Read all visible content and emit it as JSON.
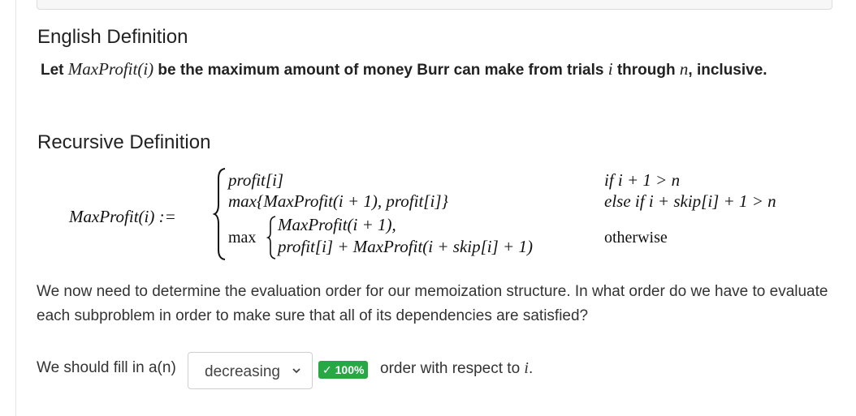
{
  "headings": {
    "english": "English Definition",
    "recursive": "Recursive Definition"
  },
  "definition": {
    "let": "Let",
    "func": "MaxProfit(i)",
    "mid": "be the maximum amount of money Burr can make from trials",
    "i": "i",
    "through": "through",
    "n": "n",
    "tail": ", inclusive."
  },
  "recursion": {
    "lhs": "MaxProfit(i) :=",
    "case1_expr": "profit[i]",
    "case1_cond": "if i + 1 > n",
    "case2_expr": "max{MaxProfit(i + 1), profit[i]}",
    "case2_cond": "else if i + skip[i] + 1 > n",
    "case3_max": "max",
    "case3_line1": "MaxProfit(i + 1),",
    "case3_line2": "profit[i] + MaxProfit(i + skip[i] + 1)",
    "case3_cond": "otherwise"
  },
  "paragraph": "We now need to determine the evaluation order for our memoization structure. In what order do we have to evaluate each subproblem in order to make sure that all of its dependencies are satisfied?",
  "question": {
    "prefix": "We should fill in a(n)",
    "selected": "decreasing",
    "badge": "✓ 100%",
    "suffix": "order with respect to",
    "var": "i",
    "period": "."
  },
  "colors": {
    "badge": "#28a745"
  }
}
